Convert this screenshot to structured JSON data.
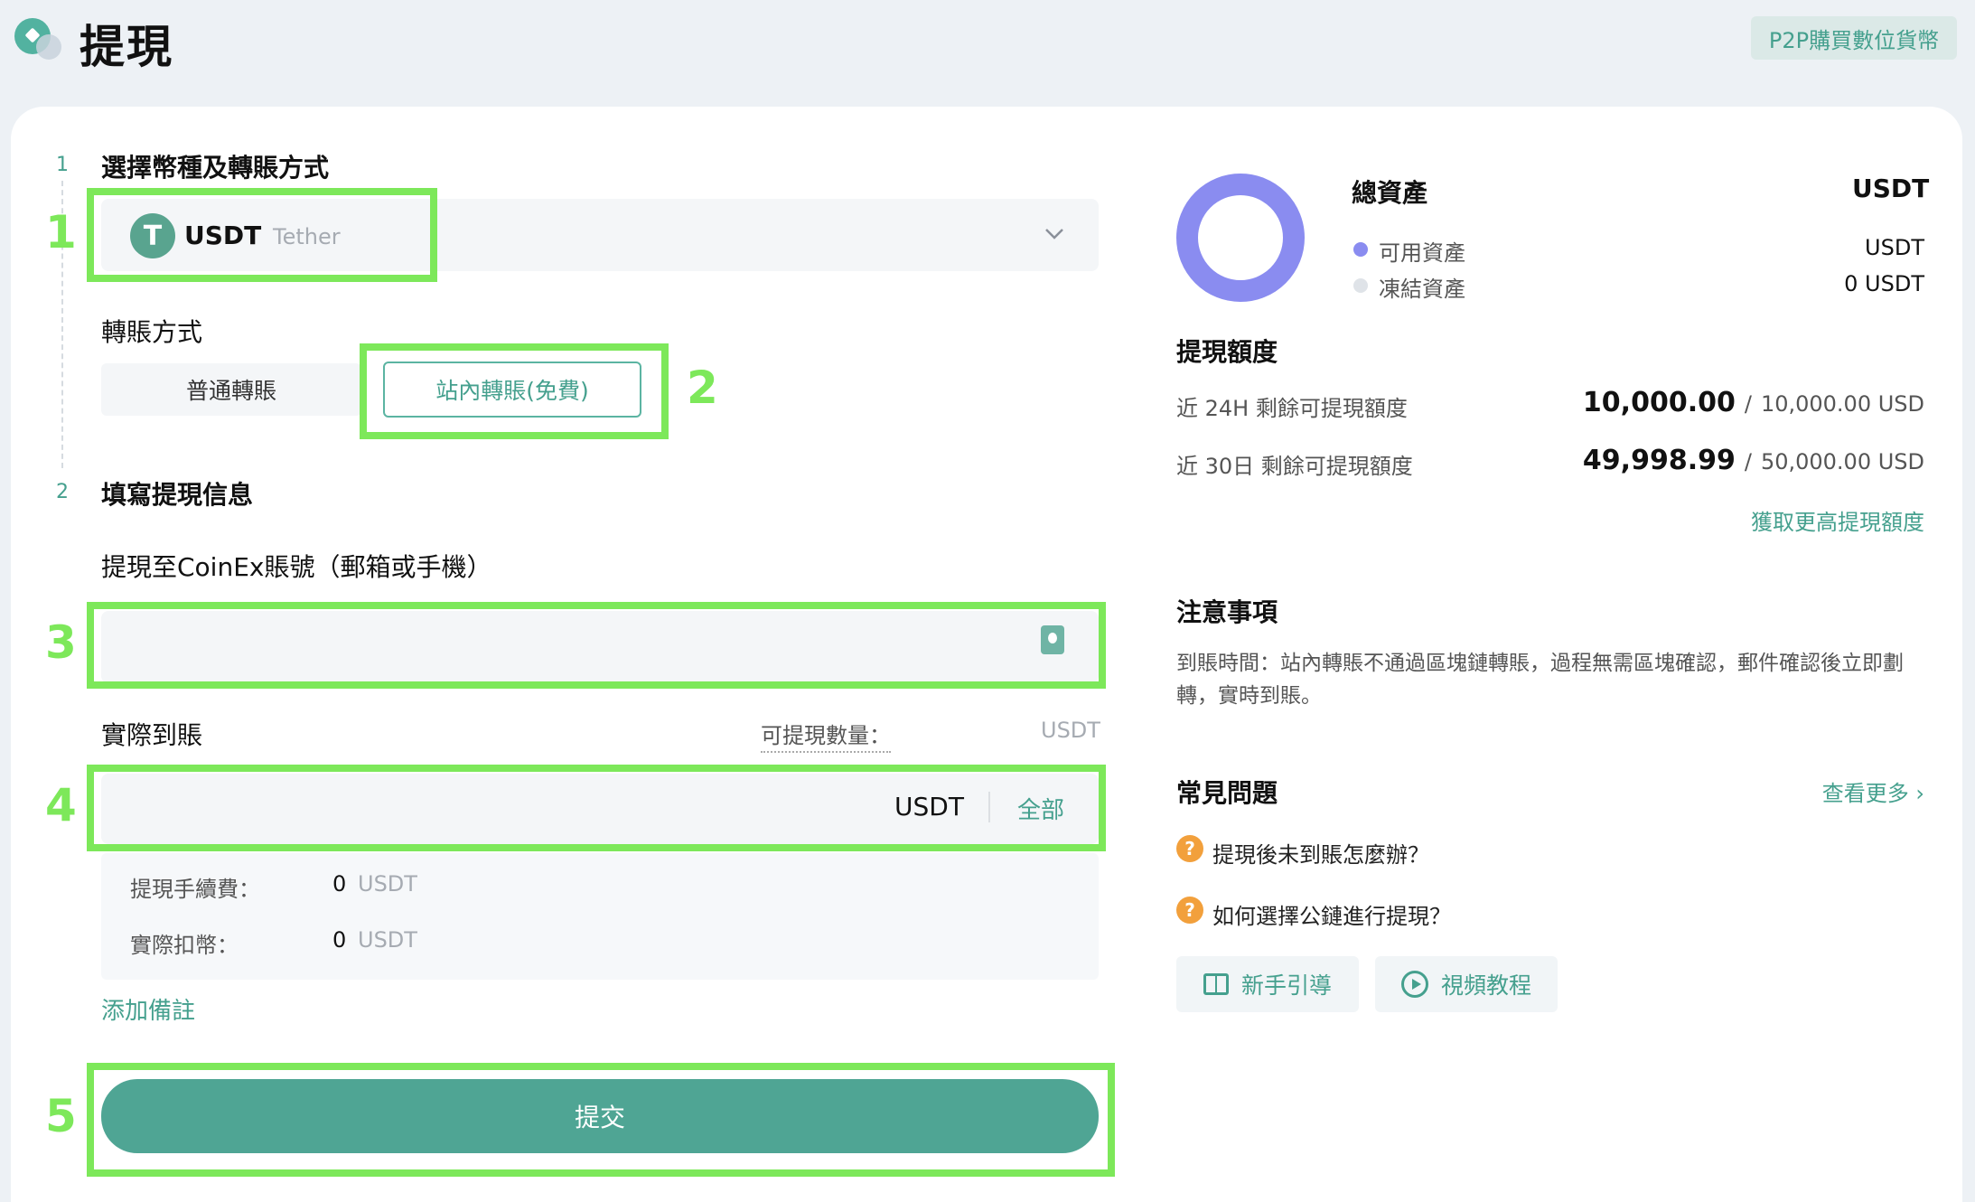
{
  "header": {
    "title": "提現",
    "p2p_button": "P2P購買數位貨幣"
  },
  "steps": [
    {
      "num": "1",
      "title": "選擇幣種及轉賬方式"
    },
    {
      "num": "2",
      "title": "填寫提現信息"
    }
  ],
  "coin": {
    "icon": "T",
    "symbol": "USDT",
    "name": "Tether"
  },
  "transfer": {
    "label": "轉賬方式",
    "options": [
      "普通轉賬",
      "站內轉賬(免費)"
    ],
    "selected": "站內轉賬(免費)"
  },
  "account": {
    "label": "提現至CoinEx賬號（郵箱或手機）",
    "value": "",
    "placeholder": ""
  },
  "amount": {
    "label": "實際到賬",
    "available_label": "可提現數量：",
    "available_unit": "USDT",
    "value": "",
    "unit": "USDT",
    "all_label": "全部"
  },
  "fees": {
    "withdraw_fee_label": "提現手續費：",
    "withdraw_fee_value": "0",
    "withdraw_fee_unit": "USDT",
    "deduct_label": "實際扣幣：",
    "deduct_value": "0",
    "deduct_unit": "USDT"
  },
  "add_remark": "添加備註",
  "submit": "提交",
  "annotations": [
    "1",
    "2",
    "3",
    "4",
    "5"
  ],
  "assets": {
    "title": "總資產",
    "unit": "USDT",
    "available_label": "可用資產",
    "available_value": "USDT",
    "frozen_label": "凍結資產",
    "frozen_value": "0 USDT",
    "ring_color": "#8a8cf0",
    "frozen_color": "#dfe3e8"
  },
  "limits": {
    "title": "提現額度",
    "rows": [
      {
        "label": "近 24H 剩餘可提現額度",
        "value": "10,000.00",
        "total": "10,000.00 USD"
      },
      {
        "label": "近 30日 剩餘可提現額度",
        "value": "49,998.99",
        "total": "50,000.00 USD"
      }
    ],
    "link": "獲取更高提現額度"
  },
  "notes": {
    "title": "注意事項",
    "text": "到賬時間：站內轉賬不通過區塊鏈轉賬，過程無需區塊確認，郵件確認後立即劃轉，實時到賬。"
  },
  "faq": {
    "title": "常見問題",
    "more": "查看更多 ›",
    "items": [
      "提現後未到賬怎麼辦？",
      "如何選擇公鏈進行提現？"
    ],
    "guide_label": "新手引導",
    "video_label": "視頻教程"
  },
  "colors": {
    "accent": "#45a08e",
    "button": "#4fa594",
    "highlight": "#7de85a"
  }
}
